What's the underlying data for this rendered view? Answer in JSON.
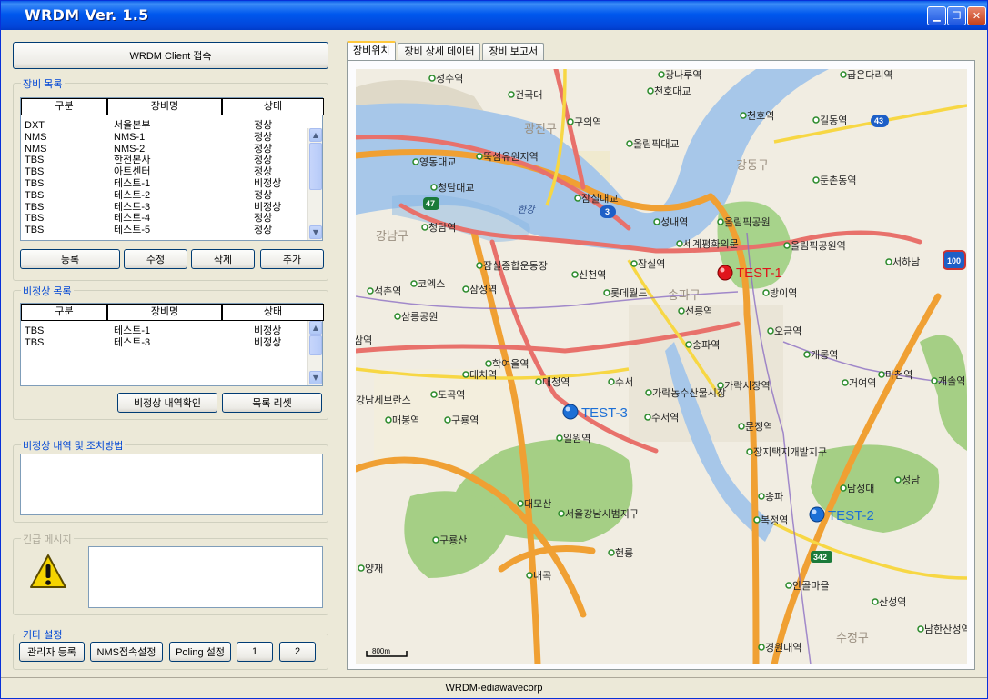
{
  "window": {
    "title": "WRDM  Ver. 1.5",
    "min_icon": "minimize-icon",
    "max_icon": "maximize-icon",
    "close_icon": "close-icon"
  },
  "connect_button": "WRDM Client 접속",
  "device_list": {
    "label": "장비 목록",
    "columns": [
      "구분",
      "장비명",
      "상태"
    ],
    "rows": [
      [
        "DXT",
        "서울본부",
        "정상"
      ],
      [
        "NMS",
        "NMS-1",
        "정상"
      ],
      [
        "NMS",
        "NMS-2",
        "정상"
      ],
      [
        "TBS",
        "한전본사",
        "정상"
      ],
      [
        "TBS",
        "아트센터",
        "정상"
      ],
      [
        "TBS",
        "테스트-1",
        "비정상"
      ],
      [
        "TBS",
        "테스트-2",
        "정상"
      ],
      [
        "TBS",
        "테스트-3",
        "비정상"
      ],
      [
        "TBS",
        "테스트-4",
        "정상"
      ],
      [
        "TBS",
        "테스트-5",
        "정상"
      ]
    ],
    "buttons": [
      "등록",
      "수정",
      "삭제",
      "추가"
    ]
  },
  "abnormal_list": {
    "label": "비정상 목록",
    "columns": [
      "구분",
      "장비명",
      "상태"
    ],
    "rows": [
      [
        "TBS",
        "테스트-1",
        "비정상"
      ],
      [
        "TBS",
        "테스트-3",
        "비정상"
      ]
    ],
    "buttons": [
      "비정상 내역확인",
      "목록 리셋"
    ]
  },
  "abnormal_detail": {
    "label": "비정상 내역 및 조치방법",
    "value": ""
  },
  "emergency": {
    "label": "긴급 메시지",
    "icon": "warning-icon",
    "value": ""
  },
  "other_settings": {
    "label": "기타 설정",
    "buttons": [
      "관리자 등록",
      "NMS접속설정",
      "Poling 설정",
      "1",
      "2"
    ]
  },
  "tabs": [
    "장비위치",
    "장비 상세 데이터",
    "장비 보고서"
  ],
  "map": {
    "markers": [
      {
        "label": "TEST-1",
        "color": "#e0151b"
      },
      {
        "label": "TEST-2",
        "color": "#1c6fd6"
      },
      {
        "label": "TEST-3",
        "color": "#1c6fd6"
      }
    ],
    "districts": [
      "광진구",
      "강동구",
      "강남구",
      "송파구",
      "수정구"
    ],
    "stations": [
      "성수역",
      "광나루역",
      "굽은다리역",
      "건국대",
      "천호대교",
      "천호역",
      "길동역",
      "구의역",
      "올림픽대교",
      "뚝섬유원지역",
      "영동대교",
      "청담대교",
      "둔촌동역",
      "잠실대교",
      "청담역",
      "성내역",
      "올림픽공원",
      "세계평화의문",
      "올림픽공원역",
      "서하남",
      "잠실종합운동장",
      "신천역",
      "잠실역",
      "방이역",
      "삼성역",
      "코엑스",
      "롯데월드",
      "석촌역",
      "삼릉공원",
      "선릉역",
      "오금역",
      "송파역",
      "개롱역",
      "학여울역",
      "삼역",
      "대치역",
      "대청역",
      "수서",
      "가락시장역",
      "거여역",
      "마천역",
      "개솔역",
      "가락농수산물시장",
      "강남세브란스",
      "도곡역",
      "매봉역",
      "구룡역",
      "수서역",
      "문정역",
      "일원역",
      "장지택지개발지구",
      "대모산",
      "서울강남시범지구",
      "송파",
      "복정역",
      "남성대",
      "성남",
      "구룡산",
      "헌릉",
      "양재",
      "내곡",
      "안골마을",
      "산성역",
      "남한산성역",
      "경원대역"
    ],
    "water": "한강",
    "routes": [
      "47",
      "3",
      "43",
      "100",
      "342"
    ],
    "scale": "800m"
  },
  "status": "WRDM-ediawavecorp"
}
